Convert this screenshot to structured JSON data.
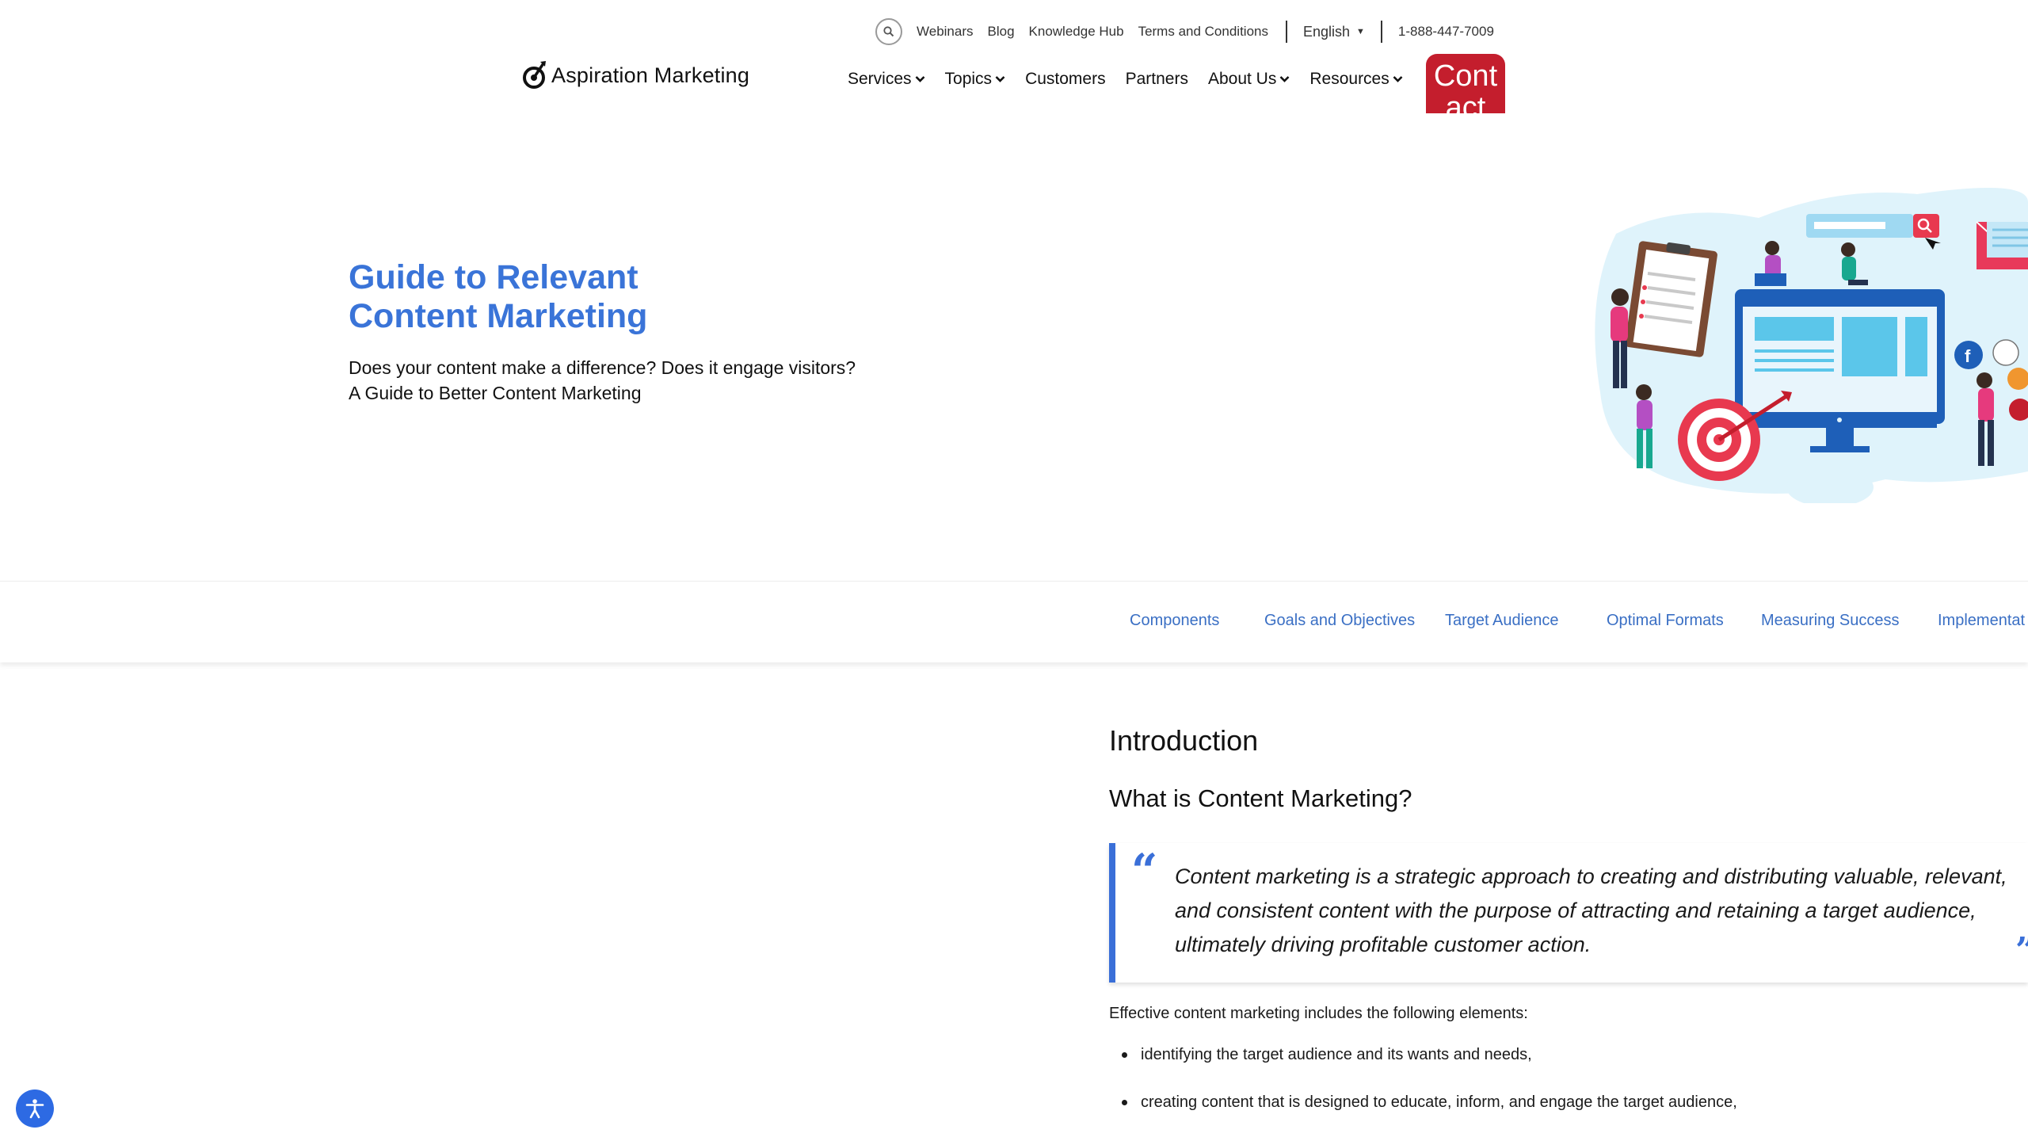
{
  "utility_bar": {
    "links": [
      "Webinars",
      "Blog",
      "Knowledge Hub",
      "Terms and Conditions"
    ],
    "language": "English",
    "phone": "1-888-447-7009"
  },
  "logo": {
    "text": "Aspiration Marketing"
  },
  "nav": {
    "items": [
      {
        "label": "Services",
        "dropdown": true
      },
      {
        "label": "Topics",
        "dropdown": true
      },
      {
        "label": "Customers",
        "dropdown": false
      },
      {
        "label": "Partners",
        "dropdown": false
      },
      {
        "label": "About Us",
        "dropdown": true
      },
      {
        "label": "Resources",
        "dropdown": true
      }
    ],
    "contact_label_line1": "Cont",
    "contact_label_line2": "act"
  },
  "hero": {
    "title_line1": "Guide to Relevant",
    "title_line2": "Content Marketing",
    "subtitle_line1": "Does your content make a difference? Does it engage visitors?",
    "subtitle_line2": "A Guide to Better Content Marketing"
  },
  "section_tabs": [
    "Components",
    "Goals and Objectives",
    "Target Audience",
    "Optimal Formats",
    "Measuring Success",
    "Implementat"
  ],
  "content": {
    "intro_heading": "Introduction",
    "what_heading": "What is Content Marketing?",
    "quote_line1": "Content marketing is a strategic approach to creating and distributing valuable, relevant,",
    "quote_line2": "and consistent content with the purpose of attracting and retaining a target audience,",
    "quote_line3": "ultimately driving profitable customer action.",
    "elements_intro": "Effective content marketing includes the following elements:",
    "bullets": [
      "identifying the target audience and its wants and needs,",
      "creating content that is designed to educate, inform, and engage the target audience,"
    ]
  },
  "colors": {
    "accent_blue": "#3a74d8",
    "contact_red": "#c41e2d",
    "a11y_blue": "#2d6ae3"
  },
  "icons": [
    "search-icon",
    "logo-mark-icon",
    "chevron-down-icon",
    "quote-open-icon",
    "quote-close-icon",
    "accessibility-icon"
  ]
}
